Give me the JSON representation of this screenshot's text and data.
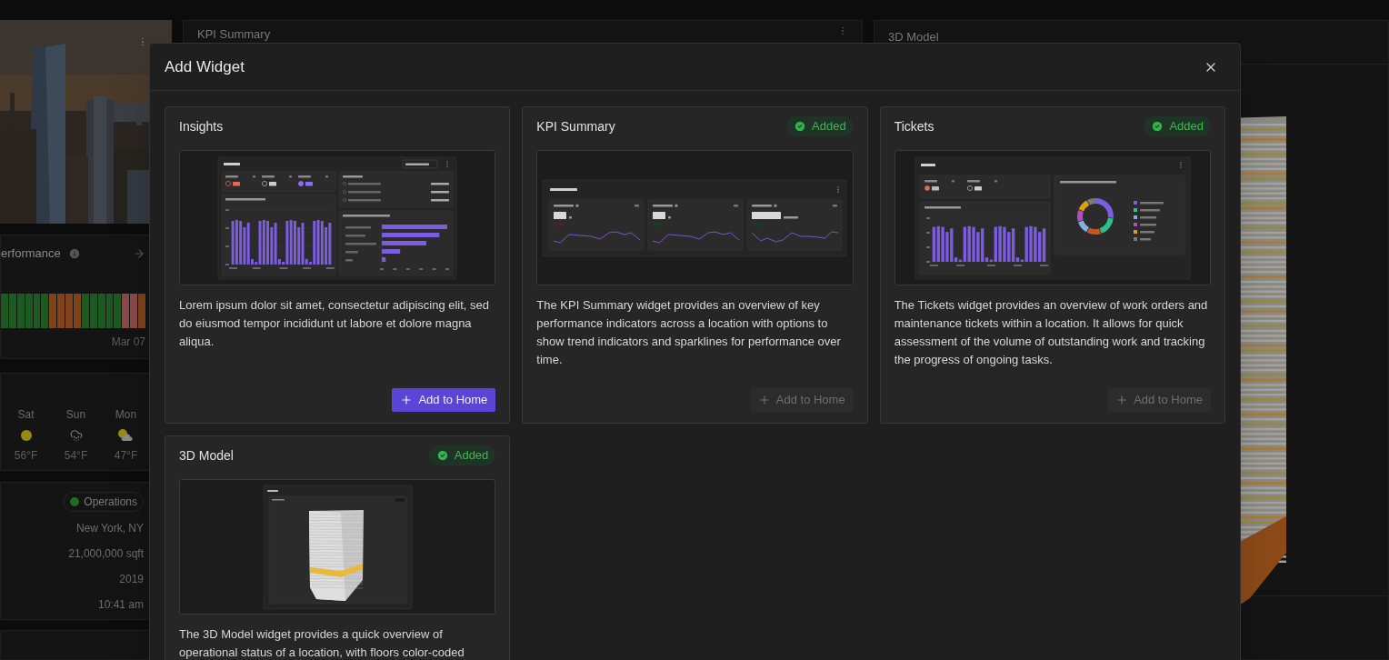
{
  "background": {
    "kpi_card": {
      "title": "KPI Summary"
    },
    "model_card": {
      "title": "3D Model"
    },
    "left_panel": {
      "performance": {
        "title": "erformance",
        "date": "Mar 07",
        "strip": [
          {
            "color": "#1d5a20"
          },
          {
            "color": "#1d5a20"
          },
          {
            "color": "#1d5a20"
          },
          {
            "color": "#1d5a20"
          },
          {
            "color": "#1d5a20"
          },
          {
            "color": "#1d5a20"
          },
          {
            "color": "#7f4219"
          },
          {
            "color": "#7f4219"
          },
          {
            "color": "#7f4219"
          },
          {
            "color": "#7f4219"
          },
          {
            "color": "#1d5a20"
          },
          {
            "color": "#1d5a20"
          },
          {
            "color": "#1d5a20"
          },
          {
            "color": "#1d5a20"
          },
          {
            "color": "#1d5a20"
          },
          {
            "color": "#8a4a4a"
          },
          {
            "color": "#8a4a4a"
          },
          {
            "color": "#7f4219"
          }
        ]
      },
      "weather": [
        {
          "day": "Sat",
          "kind": "sun",
          "temp": "56°F"
        },
        {
          "day": "Sun",
          "kind": "rain",
          "temp": "54°F"
        },
        {
          "day": "Mon",
          "kind": "partly-cloudy",
          "temp": "47°F"
        }
      ],
      "status": {
        "label": "Operations",
        "color": "#1e6b22"
      },
      "details": [
        "New York, NY",
        "21,000,000 sqft",
        "2019",
        "10:41 am"
      ]
    }
  },
  "dialog": {
    "title": "Add Widget",
    "widgets": [
      {
        "title": "Insights",
        "added": false,
        "description": "Lorem ipsum dolor sit amet, consectetur adipiscing elit, sed do eiusmod tempor incididunt ut labore et dolore magna aliqua.",
        "button": {
          "label": "Add to Home",
          "disabled": false
        },
        "preview": {
          "kind": "insights"
        }
      },
      {
        "title": "KPI Summary",
        "added": true,
        "badge": "Added",
        "description": "The KPI Summary widget provides an overview of key performance indicators across a location with options to show trend indicators and sparklines for performance over time.",
        "button": {
          "label": "Add to Home",
          "disabled": true
        },
        "preview": {
          "kind": "kpi"
        }
      },
      {
        "title": "Tickets",
        "added": true,
        "badge": "Added",
        "description": "The Tickets widget provides an overview of work orders and maintenance tickets within a location. It allows for quick assessment of the volume of outstanding work and tracking the progress of ongoing tasks.",
        "button": {
          "label": "Add to Home",
          "disabled": true
        },
        "preview": {
          "kind": "tickets"
        }
      },
      {
        "title": "3D Model",
        "added": true,
        "badge": "Added",
        "description": "The 3D Model widget provides a quick overview of operational status of a location, with floors color-coded",
        "preview": {
          "kind": "model"
        }
      }
    ]
  }
}
